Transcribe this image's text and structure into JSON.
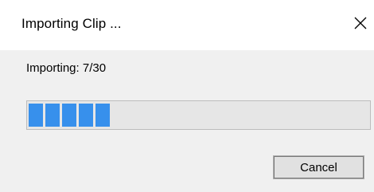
{
  "window": {
    "title": "Importing Clip ...",
    "close_icon": "close-icon"
  },
  "status": {
    "text": "Importing: 7/30"
  },
  "progress": {
    "current": 7,
    "total": 30,
    "fraction": 0.233,
    "color": "#3790ec"
  },
  "buttons": {
    "cancel_label": "Cancel"
  }
}
